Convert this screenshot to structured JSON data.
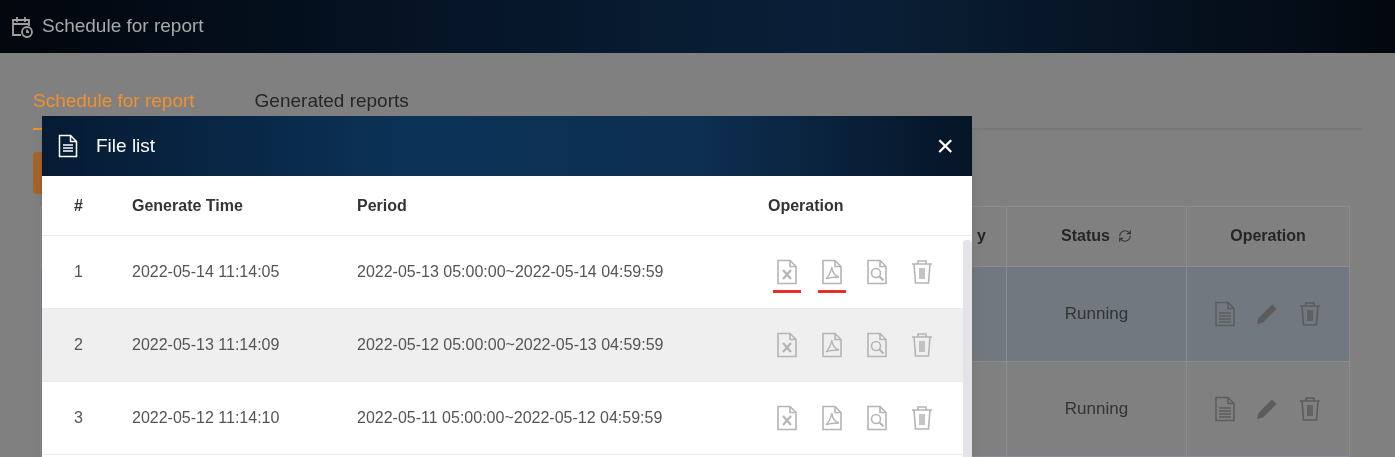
{
  "page": {
    "title": "Schedule for report"
  },
  "tabs": [
    {
      "label": "Schedule for report",
      "selected": true
    },
    {
      "label": "Generated reports",
      "selected": false
    }
  ],
  "schedule_table": {
    "columns": [
      "y",
      "Status",
      "Operation"
    ],
    "rows": [
      {
        "status": "Running",
        "selected": true
      },
      {
        "status": "Running",
        "selected": false
      }
    ]
  },
  "dialog": {
    "title": "File list",
    "close": "×",
    "columns": [
      "#",
      "Generate Time",
      "Period",
      "Operation"
    ],
    "rows": [
      {
        "index": "1",
        "generate_time": "2022-05-14 11:14:05",
        "period": "2022-05-13 05:00:00~2022-05-14 04:59:59",
        "highlighted": false,
        "operations": [
          {
            "kind": "excel",
            "marked": true
          },
          {
            "kind": "pdf",
            "marked": true
          },
          {
            "kind": "preview",
            "marked": false
          },
          {
            "kind": "delete",
            "marked": false
          }
        ]
      },
      {
        "index": "2",
        "generate_time": "2022-05-13 11:14:09",
        "period": "2022-05-12 05:00:00~2022-05-13 04:59:59",
        "highlighted": true,
        "operations": [
          {
            "kind": "excel",
            "marked": false
          },
          {
            "kind": "pdf",
            "marked": false
          },
          {
            "kind": "preview",
            "marked": false
          },
          {
            "kind": "delete",
            "marked": false
          }
        ]
      },
      {
        "index": "3",
        "generate_time": "2022-05-12 11:14:10",
        "period": "2022-05-11 05:00:00~2022-05-12 04:59:59",
        "highlighted": false,
        "operations": [
          {
            "kind": "excel",
            "marked": false
          },
          {
            "kind": "pdf",
            "marked": false
          },
          {
            "kind": "preview",
            "marked": false
          },
          {
            "kind": "delete",
            "marked": false
          }
        ]
      }
    ]
  }
}
